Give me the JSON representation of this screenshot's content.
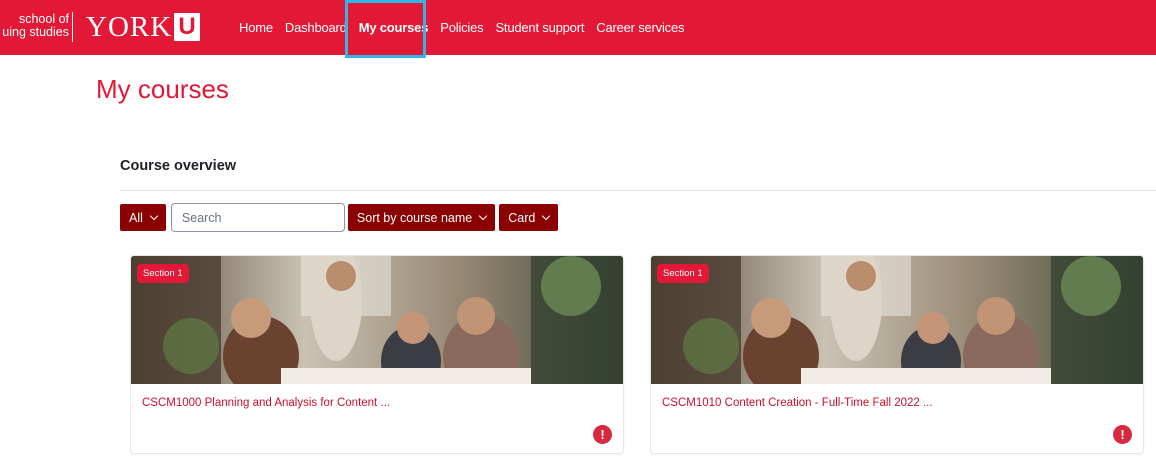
{
  "logo": {
    "subtitle_line1": "school of",
    "subtitle_line2": "uing studies",
    "wordmark": "YORK",
    "mark": "U"
  },
  "nav": {
    "items": [
      {
        "label": "Home"
      },
      {
        "label": "Dashboard"
      },
      {
        "label": "My courses",
        "active": true
      },
      {
        "label": "Policies"
      },
      {
        "label": "Student support"
      },
      {
        "label": "Career services"
      }
    ]
  },
  "page": {
    "title": "My courses"
  },
  "overview": {
    "title": "Course overview",
    "filter_label": "All",
    "search_placeholder": "Search",
    "sort_label": "Sort by course name",
    "view_label": "Card"
  },
  "courses": [
    {
      "badge": "Section 1",
      "name": "CSCM1000 Planning and Analysis for Content ...",
      "alert_icon": "exclamation-icon"
    },
    {
      "badge": "Section 1",
      "name": "CSCM1010 Content Creation - Full-Time Fall 2022 ...",
      "alert_icon": "exclamation-icon"
    }
  ],
  "colors": {
    "brand_red": "#e31837",
    "button_dark_red": "#8b0000",
    "focus_outline": "#2fb8e7",
    "course_link": "#c8102e"
  }
}
